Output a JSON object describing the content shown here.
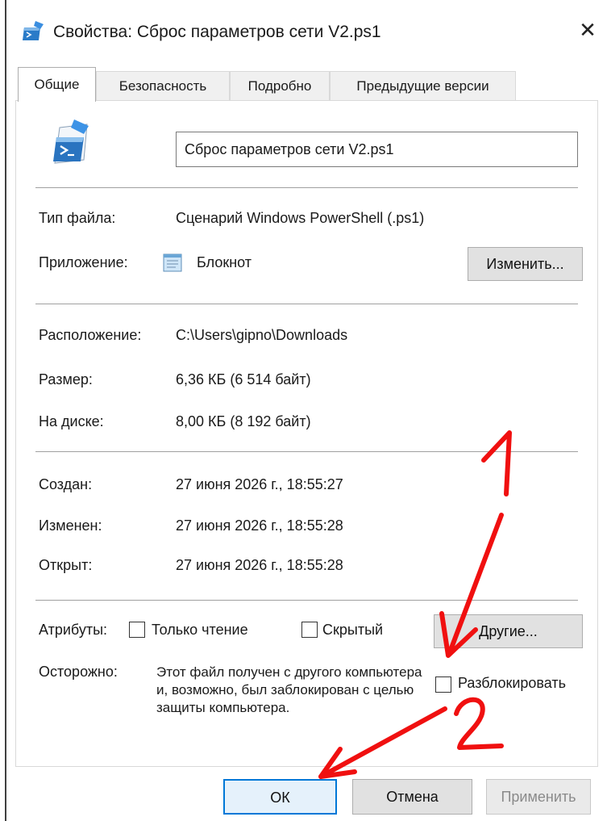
{
  "window": {
    "title": "Свойства: Сброс параметров сети V2.ps1",
    "close_glyph": "✕"
  },
  "tabs": [
    {
      "label": "Общие",
      "active": true
    },
    {
      "label": "Безопасность",
      "active": false
    },
    {
      "label": "Подробно",
      "active": false
    },
    {
      "label": "Предыдущие версии",
      "active": false
    }
  ],
  "general": {
    "file_name": "Сброс параметров сети V2.ps1",
    "file_type_label": "Тип файла:",
    "file_type_value": "Сценарий Windows PowerShell (.ps1)",
    "app_label": "Приложение:",
    "app_value": "Блокнот",
    "change_button": "Изменить...",
    "location_label": "Расположение:",
    "location_value": "C:\\Users\\gipno\\Downloads",
    "size_label": "Размер:",
    "size_value": "6,36 КБ (6 514 байт)",
    "disk_label": "На диске:",
    "disk_value": "8,00 КБ (8 192 байт)",
    "created_label": "Создан:",
    "created_value": "27 июня 2026 г., 18:55:27",
    "modified_label": "Изменен:",
    "modified_value": "27 июня 2026 г., 18:55:28",
    "opened_label": "Открыт:",
    "opened_value": "27 июня 2026 г., 18:55:28",
    "attributes_label": "Атрибуты:",
    "readonly_label": "Только чтение",
    "readonly_checked": false,
    "hidden_label": "Скрытый",
    "hidden_checked": false,
    "other_button": "Другие...",
    "warning_label": "Осторожно:",
    "warning_text": "Этот файл получен с другого компьютера и, возможно, был заблокирован с целью защиты компьютера.",
    "unblock_label": "Разблокировать",
    "unblock_checked": false
  },
  "buttons": {
    "ok": "ОК",
    "cancel": "Отмена",
    "apply": "Применить"
  },
  "annotations": {
    "label_1": "1",
    "label_2": "2",
    "color": "#f01010"
  },
  "icons": {
    "title": "powershell-script-icon",
    "file": "powershell-script-icon",
    "app": "notepad-icon",
    "close": "close-icon"
  }
}
